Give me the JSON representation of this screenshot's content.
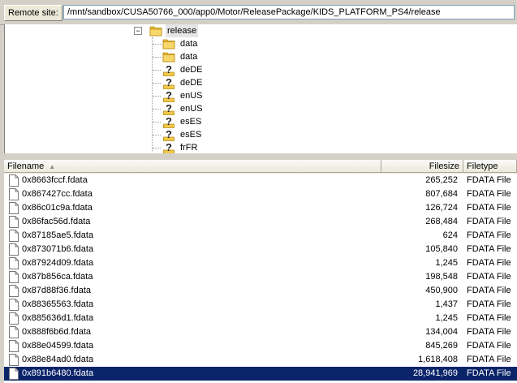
{
  "remote_site": {
    "label": "Remote site:",
    "path": "/mnt/sandbox/CUSA50766_000/app0/Motor/ReleasePackage/KIDS_PLATFORM_PS4/release"
  },
  "tree": {
    "root": {
      "label": "release",
      "expander": "−",
      "icon": "folder-open-icon"
    },
    "children": [
      {
        "label": "data",
        "icon": "folder-icon"
      },
      {
        "label": "data",
        "icon": "folder-icon"
      },
      {
        "label": "deDE",
        "icon": "unknown-folder-icon"
      },
      {
        "label": "deDE",
        "icon": "unknown-folder-icon"
      },
      {
        "label": "enUS",
        "icon": "unknown-folder-icon"
      },
      {
        "label": "enUS",
        "icon": "unknown-folder-icon"
      },
      {
        "label": "esES",
        "icon": "unknown-folder-icon"
      },
      {
        "label": "esES",
        "icon": "unknown-folder-icon"
      },
      {
        "label": "frFR",
        "icon": "unknown-folder-icon"
      }
    ]
  },
  "file_list": {
    "columns": {
      "name": "Filename",
      "size": "Filesize",
      "type": "Filetype"
    },
    "sorted_by": "Filename",
    "selection_color": "#0a246a",
    "rows": [
      {
        "name": "0x8663fccf.fdata",
        "size": "265,252",
        "type": "FDATA File"
      },
      {
        "name": "0x867427cc.fdata",
        "size": "807,684",
        "type": "FDATA File"
      },
      {
        "name": "0x86c01c9a.fdata",
        "size": "126,724",
        "type": "FDATA File"
      },
      {
        "name": "0x86fac56d.fdata",
        "size": "268,484",
        "type": "FDATA File"
      },
      {
        "name": "0x87185ae5.fdata",
        "size": "624",
        "type": "FDATA File"
      },
      {
        "name": "0x873071b6.fdata",
        "size": "105,840",
        "type": "FDATA File"
      },
      {
        "name": "0x87924d09.fdata",
        "size": "1,245",
        "type": "FDATA File"
      },
      {
        "name": "0x87b856ca.fdata",
        "size": "198,548",
        "type": "FDATA File"
      },
      {
        "name": "0x87d88f36.fdata",
        "size": "450,900",
        "type": "FDATA File"
      },
      {
        "name": "0x88365563.fdata",
        "size": "1,437",
        "type": "FDATA File"
      },
      {
        "name": "0x885636d1.fdata",
        "size": "1,245",
        "type": "FDATA File"
      },
      {
        "name": "0x888f6b6d.fdata",
        "size": "134,004",
        "type": "FDATA File"
      },
      {
        "name": "0x88e04599.fdata",
        "size": "845,269",
        "type": "FDATA File"
      },
      {
        "name": "0x88e84ad0.fdata",
        "size": "1,618,408",
        "type": "FDATA File"
      },
      {
        "name": "0x891b6480.fdata",
        "size": "28,941,969",
        "type": "FDATA File",
        "selected": true
      }
    ]
  }
}
